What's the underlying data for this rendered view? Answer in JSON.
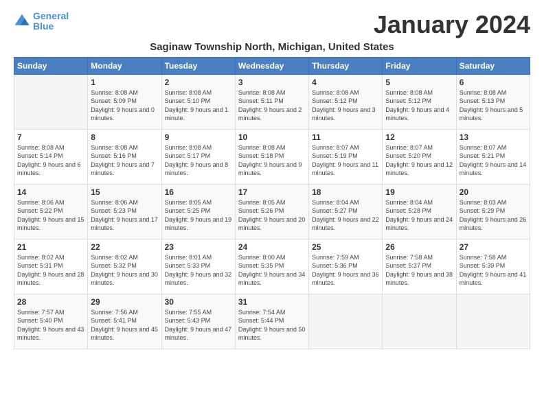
{
  "header": {
    "logo_line1": "General",
    "logo_line2": "Blue",
    "month": "January 2024",
    "location": "Saginaw Township North, Michigan, United States"
  },
  "weekdays": [
    "Sunday",
    "Monday",
    "Tuesday",
    "Wednesday",
    "Thursday",
    "Friday",
    "Saturday"
  ],
  "weeks": [
    [
      {
        "day": "",
        "sunrise": "",
        "sunset": "",
        "daylight": ""
      },
      {
        "day": "1",
        "sunrise": "Sunrise: 8:08 AM",
        "sunset": "Sunset: 5:09 PM",
        "daylight": "Daylight: 9 hours and 0 minutes."
      },
      {
        "day": "2",
        "sunrise": "Sunrise: 8:08 AM",
        "sunset": "Sunset: 5:10 PM",
        "daylight": "Daylight: 9 hours and 1 minute."
      },
      {
        "day": "3",
        "sunrise": "Sunrise: 8:08 AM",
        "sunset": "Sunset: 5:11 PM",
        "daylight": "Daylight: 9 hours and 2 minutes."
      },
      {
        "day": "4",
        "sunrise": "Sunrise: 8:08 AM",
        "sunset": "Sunset: 5:12 PM",
        "daylight": "Daylight: 9 hours and 3 minutes."
      },
      {
        "day": "5",
        "sunrise": "Sunrise: 8:08 AM",
        "sunset": "Sunset: 5:12 PM",
        "daylight": "Daylight: 9 hours and 4 minutes."
      },
      {
        "day": "6",
        "sunrise": "Sunrise: 8:08 AM",
        "sunset": "Sunset: 5:13 PM",
        "daylight": "Daylight: 9 hours and 5 minutes."
      }
    ],
    [
      {
        "day": "7",
        "sunrise": "Sunrise: 8:08 AM",
        "sunset": "Sunset: 5:14 PM",
        "daylight": "Daylight: 9 hours and 6 minutes."
      },
      {
        "day": "8",
        "sunrise": "Sunrise: 8:08 AM",
        "sunset": "Sunset: 5:16 PM",
        "daylight": "Daylight: 9 hours and 7 minutes."
      },
      {
        "day": "9",
        "sunrise": "Sunrise: 8:08 AM",
        "sunset": "Sunset: 5:17 PM",
        "daylight": "Daylight: 9 hours and 8 minutes."
      },
      {
        "day": "10",
        "sunrise": "Sunrise: 8:08 AM",
        "sunset": "Sunset: 5:18 PM",
        "daylight": "Daylight: 9 hours and 9 minutes."
      },
      {
        "day": "11",
        "sunrise": "Sunrise: 8:07 AM",
        "sunset": "Sunset: 5:19 PM",
        "daylight": "Daylight: 9 hours and 11 minutes."
      },
      {
        "day": "12",
        "sunrise": "Sunrise: 8:07 AM",
        "sunset": "Sunset: 5:20 PM",
        "daylight": "Daylight: 9 hours and 12 minutes."
      },
      {
        "day": "13",
        "sunrise": "Sunrise: 8:07 AM",
        "sunset": "Sunset: 5:21 PM",
        "daylight": "Daylight: 9 hours and 14 minutes."
      }
    ],
    [
      {
        "day": "14",
        "sunrise": "Sunrise: 8:06 AM",
        "sunset": "Sunset: 5:22 PM",
        "daylight": "Daylight: 9 hours and 15 minutes."
      },
      {
        "day": "15",
        "sunrise": "Sunrise: 8:06 AM",
        "sunset": "Sunset: 5:23 PM",
        "daylight": "Daylight: 9 hours and 17 minutes."
      },
      {
        "day": "16",
        "sunrise": "Sunrise: 8:05 AM",
        "sunset": "Sunset: 5:25 PM",
        "daylight": "Daylight: 9 hours and 19 minutes."
      },
      {
        "day": "17",
        "sunrise": "Sunrise: 8:05 AM",
        "sunset": "Sunset: 5:26 PM",
        "daylight": "Daylight: 9 hours and 20 minutes."
      },
      {
        "day": "18",
        "sunrise": "Sunrise: 8:04 AM",
        "sunset": "Sunset: 5:27 PM",
        "daylight": "Daylight: 9 hours and 22 minutes."
      },
      {
        "day": "19",
        "sunrise": "Sunrise: 8:04 AM",
        "sunset": "Sunset: 5:28 PM",
        "daylight": "Daylight: 9 hours and 24 minutes."
      },
      {
        "day": "20",
        "sunrise": "Sunrise: 8:03 AM",
        "sunset": "Sunset: 5:29 PM",
        "daylight": "Daylight: 9 hours and 26 minutes."
      }
    ],
    [
      {
        "day": "21",
        "sunrise": "Sunrise: 8:02 AM",
        "sunset": "Sunset: 5:31 PM",
        "daylight": "Daylight: 9 hours and 28 minutes."
      },
      {
        "day": "22",
        "sunrise": "Sunrise: 8:02 AM",
        "sunset": "Sunset: 5:32 PM",
        "daylight": "Daylight: 9 hours and 30 minutes."
      },
      {
        "day": "23",
        "sunrise": "Sunrise: 8:01 AM",
        "sunset": "Sunset: 5:33 PM",
        "daylight": "Daylight: 9 hours and 32 minutes."
      },
      {
        "day": "24",
        "sunrise": "Sunrise: 8:00 AM",
        "sunset": "Sunset: 5:35 PM",
        "daylight": "Daylight: 9 hours and 34 minutes."
      },
      {
        "day": "25",
        "sunrise": "Sunrise: 7:59 AM",
        "sunset": "Sunset: 5:36 PM",
        "daylight": "Daylight: 9 hours and 36 minutes."
      },
      {
        "day": "26",
        "sunrise": "Sunrise: 7:58 AM",
        "sunset": "Sunset: 5:37 PM",
        "daylight": "Daylight: 9 hours and 38 minutes."
      },
      {
        "day": "27",
        "sunrise": "Sunrise: 7:58 AM",
        "sunset": "Sunset: 5:39 PM",
        "daylight": "Daylight: 9 hours and 41 minutes."
      }
    ],
    [
      {
        "day": "28",
        "sunrise": "Sunrise: 7:57 AM",
        "sunset": "Sunset: 5:40 PM",
        "daylight": "Daylight: 9 hours and 43 minutes."
      },
      {
        "day": "29",
        "sunrise": "Sunrise: 7:56 AM",
        "sunset": "Sunset: 5:41 PM",
        "daylight": "Daylight: 9 hours and 45 minutes."
      },
      {
        "day": "30",
        "sunrise": "Sunrise: 7:55 AM",
        "sunset": "Sunset: 5:43 PM",
        "daylight": "Daylight: 9 hours and 47 minutes."
      },
      {
        "day": "31",
        "sunrise": "Sunrise: 7:54 AM",
        "sunset": "Sunset: 5:44 PM",
        "daylight": "Daylight: 9 hours and 50 minutes."
      },
      {
        "day": "",
        "sunrise": "",
        "sunset": "",
        "daylight": ""
      },
      {
        "day": "",
        "sunrise": "",
        "sunset": "",
        "daylight": ""
      },
      {
        "day": "",
        "sunrise": "",
        "sunset": "",
        "daylight": ""
      }
    ]
  ]
}
